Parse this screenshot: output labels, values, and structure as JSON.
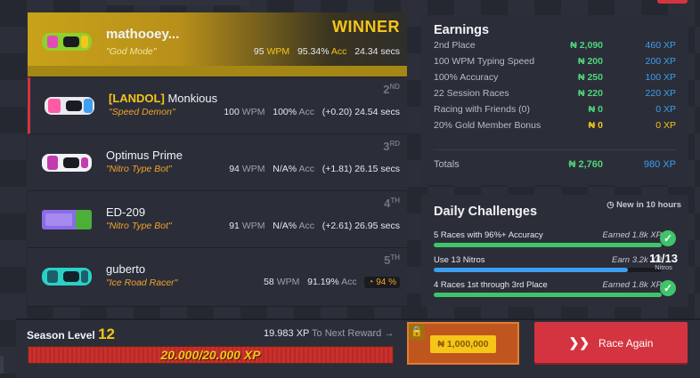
{
  "racers": [
    {
      "tag": "",
      "name": "mathooey...",
      "title": "\"God Mode\"",
      "wpm": "95",
      "acc": "95.34%",
      "time": "24.34 secs",
      "diff": "",
      "place_text": "WINNER",
      "place_sup": "",
      "car_color": "#8fd12b",
      "car_accent": "#e04cb5"
    },
    {
      "tag": "[LANDOL]",
      "name": "Monkious",
      "title": "\"Speed Demon\"",
      "wpm": "100",
      "acc": "100%",
      "time": "24.54 secs",
      "diff": "(+0.20)",
      "place_text": "2",
      "place_sup": "ND",
      "car_color": "#e9e9ef",
      "car_accent": "#ff5aa5"
    },
    {
      "tag": "",
      "name": "Optimus Prime",
      "title": "\"Nitro Type Bot\"",
      "wpm": "94",
      "acc": "N/A%",
      "time": "26.15 secs",
      "diff": "(+1.81)",
      "place_text": "3",
      "place_sup": "RD",
      "car_color": "#f2f2f5",
      "car_accent": "#c43bb0"
    },
    {
      "tag": "",
      "name": "ED-209",
      "title": "\"Nitro Type Bot\"",
      "wpm": "91",
      "acc": "N/A%",
      "time": "26.95 secs",
      "diff": "(+2.61)",
      "place_text": "4",
      "place_sup": "TH",
      "car_color": "#8c6be8",
      "car_accent": "#4caf3a"
    },
    {
      "tag": "",
      "name": "guberto",
      "title": "\"Ice Road Racer\"",
      "wpm": "58",
      "acc": "91.19%",
      "time": "",
      "diff": "",
      "progress": "94 %",
      "place_text": "5",
      "place_sup": "TH",
      "car_color": "#2bd1c8",
      "car_accent": "#1c5f6b"
    }
  ],
  "units": {
    "wpm": "WPM",
    "acc": "Acc"
  },
  "earnings": {
    "title": "Earnings",
    "rows": [
      {
        "label": "2nd Place",
        "nitros": "₦ 2,090",
        "xp": "460 XP",
        "zero": false
      },
      {
        "label": "100 WPM Typing Speed",
        "nitros": "₦ 200",
        "xp": "200 XP",
        "zero": false
      },
      {
        "label": "100% Accuracy",
        "nitros": "₦ 250",
        "xp": "100 XP",
        "zero": false
      },
      {
        "label": "22 Session Races",
        "nitros": "₦ 220",
        "xp": "220 XP",
        "zero": false
      },
      {
        "label": "Racing with Friends (0)",
        "nitros": "₦ 0",
        "xp": "0 XP",
        "zero": false
      },
      {
        "label": "20% Gold Member Bonus",
        "nitros": "₦ 0",
        "xp": "0 XP",
        "zero": true
      }
    ],
    "total_label": "Totals",
    "total_nitros": "₦ 2,760",
    "total_xp": "980 XP"
  },
  "daily": {
    "title": "Daily Challenges",
    "new_in": "New in 10 hours",
    "challenges": [
      {
        "label": "5 Races with 96%+ Accuracy",
        "status": "Earned 1.8k XP",
        "progress": 1.0,
        "color": "#3fc46a",
        "done": true
      },
      {
        "label": "Use 13 Nitros",
        "status": "Earn 3.2k XP",
        "progress": 0.85,
        "color": "#3c9ff0",
        "done": false,
        "count": "11/13",
        "count_label": "Nitros"
      },
      {
        "label": "4 Races 1st through 3rd Place",
        "status": "Earned 1.8k XP",
        "progress": 1.0,
        "color": "#3fc46a",
        "done": true
      }
    ]
  },
  "season": {
    "label": "Season Level",
    "level": "12",
    "next_xp": "19.983 XP",
    "next_label": "To Next Reward →",
    "bar_text": "20.000/20.000 XP",
    "progress": 1.0,
    "reward": "₦ 1,000,000"
  },
  "race_again": "Race Again"
}
